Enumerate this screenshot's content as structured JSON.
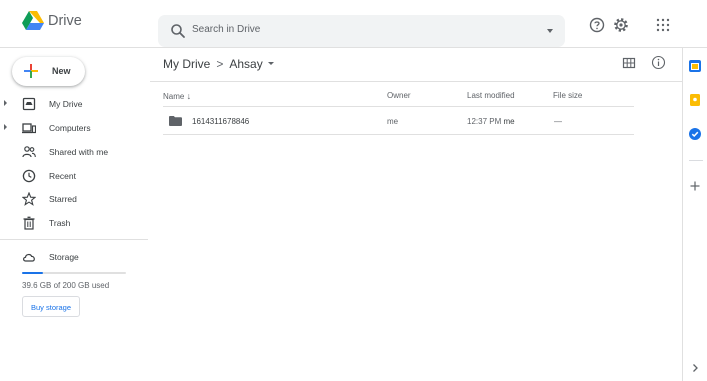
{
  "header": {
    "app_name": "Drive",
    "search_placeholder": "Search in Drive"
  },
  "sidebar": {
    "new_label": "New",
    "items": [
      {
        "label": "My Drive",
        "icon": "my-drive-icon",
        "expandable": true
      },
      {
        "label": "Computers",
        "icon": "computers-icon",
        "expandable": true
      },
      {
        "label": "Shared with me",
        "icon": "shared-icon",
        "expandable": false
      },
      {
        "label": "Recent",
        "icon": "clock-icon",
        "expandable": false
      },
      {
        "label": "Starred",
        "icon": "star-icon",
        "expandable": false
      },
      {
        "label": "Trash",
        "icon": "trash-icon",
        "expandable": false
      }
    ],
    "storage": {
      "label": "Storage",
      "used_text": "39.6 GB of 200 GB used",
      "used_fraction": 0.198,
      "buy_label": "Buy storage"
    }
  },
  "main": {
    "breadcrumb": {
      "root": "My Drive",
      "separator": ">",
      "current": "Ahsay"
    },
    "columns": {
      "name": "Name",
      "owner": "Owner",
      "modified": "Last modified",
      "size": "File size"
    },
    "rows": [
      {
        "name": "1614311678846",
        "owner": "me",
        "modified_time": "12:37 PM",
        "modified_by": "me",
        "size": "—"
      }
    ]
  },
  "colors": {
    "accent": "#1a73e8",
    "text": "#3c4043",
    "secondary": "#5f6368",
    "divider": "#e0e0e0"
  }
}
